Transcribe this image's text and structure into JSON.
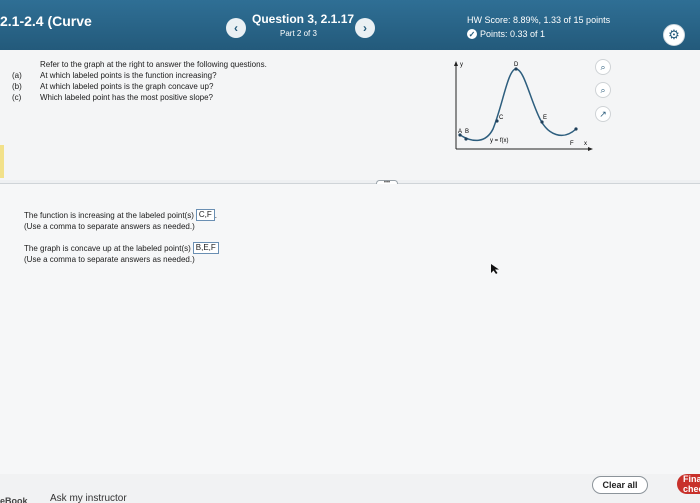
{
  "header": {
    "section_title": "2.1-2.4 (Curve",
    "prev_label": "‹",
    "next_label": "›",
    "question_title": "Question 3, 2.1.17",
    "question_part": "Part 2 of 3",
    "hw_score": "HW Score: 8.89%, 1.33 of 15 points",
    "points": "Points: 0.33 of 1",
    "gear_icon": "gear-icon"
  },
  "question": {
    "prompt": "Refer to the graph at the right to answer the following questions.",
    "items": [
      {
        "label": "(a)",
        "text": "At which labeled points is the function increasing?"
      },
      {
        "label": "(b)",
        "text": "At which labeled points is the graph concave up?"
      },
      {
        "label": "(c)",
        "text": "Which labeled point has the most positive slope?"
      }
    ]
  },
  "graph": {
    "y_axis_label": "y",
    "x_axis_label": "x",
    "function_label": "y = f(x)",
    "points": [
      "A",
      "B",
      "C",
      "D",
      "E",
      "F"
    ]
  },
  "tools": {
    "icons": [
      "zoom-in-icon",
      "zoom-out-icon",
      "popout-icon"
    ]
  },
  "answers": {
    "increasing_text": "The function is increasing at the labeled point(s)",
    "increasing_value": "C,F",
    "increasing_hint": "(Use a comma to separate answers as needed.)",
    "concave_text": "The graph is concave up at the labeled point(s)",
    "concave_value": "B,E,F",
    "concave_hint": "(Use a comma to separate answers as needed.)"
  },
  "footer": {
    "ebook": "eBook",
    "ask_instructor": "Ask my instructor",
    "clear_all": "Clear all",
    "final_check": "Final check"
  },
  "colors": {
    "header": "#235a7b",
    "accent": "#c8312b",
    "curve": "#2d5e7e"
  }
}
